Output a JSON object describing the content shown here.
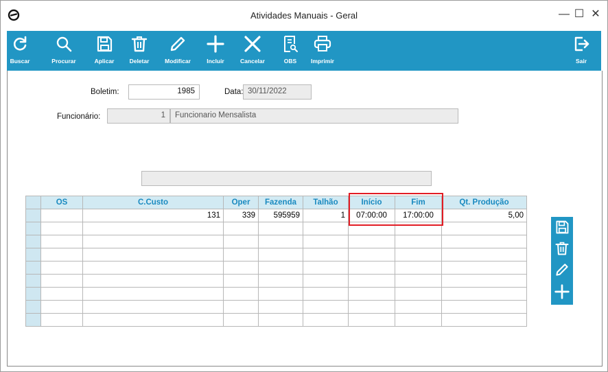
{
  "window": {
    "title": "Atividades Manuais - Geral",
    "minimize": "—",
    "maximize": "☐",
    "close": "✕"
  },
  "toolbar": {
    "buttons": [
      {
        "label": "Buscar",
        "icon": "refresh-icon"
      },
      {
        "label": "Procurar",
        "icon": "search-icon"
      },
      {
        "label": "Aplicar",
        "icon": "save-icon"
      },
      {
        "label": "Deletar",
        "icon": "trash-icon"
      },
      {
        "label": "Modificar",
        "icon": "pencil-icon"
      },
      {
        "label": "Incluir",
        "icon": "plus-icon"
      },
      {
        "label": "Cancelar",
        "icon": "close-icon"
      },
      {
        "label": "OBS",
        "icon": "document-search-icon"
      },
      {
        "label": "Imprimir",
        "icon": "printer-icon"
      }
    ],
    "exit_label": "Sair",
    "color": "#2196c4"
  },
  "form": {
    "boletim_label": "Boletim:",
    "boletim_value": "1985",
    "data_label": "Data:",
    "data_value": "30/11/2022",
    "funcionario_label": "Funcionário:",
    "funcionario_code": "1",
    "funcionario_name": "Funcionario Mensalista"
  },
  "grid": {
    "columns": [
      "OS",
      "C.Custo",
      "Oper",
      "Fazenda",
      "Talhão",
      "Início",
      "Fim",
      "Qt. Produção"
    ],
    "rows": [
      [
        "",
        "131",
        "339",
        "595959",
        "1",
        "07:00:00",
        "17:00:00",
        "5,00"
      ]
    ],
    "empty_rows": 8
  },
  "side_toolbar": {
    "icons": [
      "save-icon",
      "trash-icon",
      "pencil-icon",
      "plus-icon"
    ]
  },
  "highlight_color": "#e21c24"
}
